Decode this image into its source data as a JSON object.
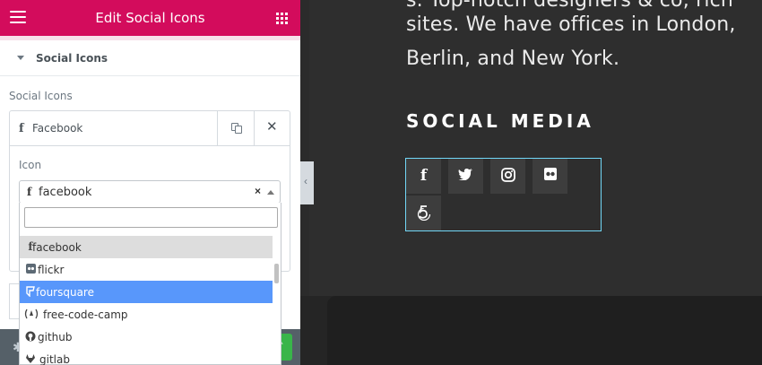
{
  "panel": {
    "title": "Edit Social Icons",
    "section_title": "Social Icons",
    "repeater_label": "Social Icons",
    "item": {
      "title": "Facebook",
      "icon_label": "Icon",
      "selected_value": "facebook",
      "search_value": "",
      "options": [
        {
          "label": "facebook",
          "icon": "facebook-icon",
          "state": "selected"
        },
        {
          "label": "flickr",
          "icon": "flickr-icon",
          "state": "normal"
        },
        {
          "label": "foursquare",
          "icon": "foursquare-icon",
          "state": "highlighted"
        },
        {
          "label": "free-code-camp",
          "icon": "free-code-camp-icon",
          "state": "normal"
        },
        {
          "label": "github",
          "icon": "github-icon",
          "state": "normal"
        },
        {
          "label": "gitlab",
          "icon": "gitlab-icon",
          "state": "normal"
        }
      ]
    }
  },
  "preview": {
    "text_lines": [
      "s. Top-notch designers & co, rich",
      "sites. We have offices in London,",
      "Berlin, and New York."
    ],
    "heading": "SOCIAL MEDIA",
    "social_icons": [
      "facebook-icon",
      "twitter-icon",
      "instagram-icon",
      "flickr-icon",
      "500px-icon"
    ]
  },
  "colors": {
    "header": "#d30c5c",
    "highlight": "#5897fb",
    "preview_bg": "#2e2e2e",
    "social_border": "#71d7f7"
  }
}
